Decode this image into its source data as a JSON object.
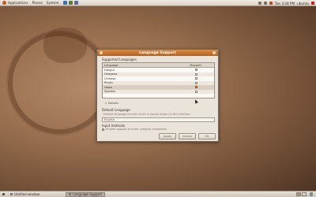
{
  "top_panel": {
    "menus": [
      "Applications",
      "Places",
      "System"
    ],
    "clock": "Tue 3:28 PM",
    "user": "ubuntu"
  },
  "window": {
    "title": "Language Support",
    "section_supported": "Supported Languages",
    "columns": [
      "Language",
      "Support",
      ""
    ],
    "languages": [
      {
        "name": "Hangul",
        "checked": false
      },
      {
        "name": "Hiragana",
        "checked": false
      },
      {
        "name": "Chinese",
        "checked": false
      },
      {
        "name": "Pinyin",
        "checked": false
      },
      {
        "name": "Hanzi",
        "checked": true
      },
      {
        "name": "Spanish",
        "checked": false
      }
    ],
    "details_label": "▷ Details",
    "default_language_label": "Default Language",
    "default_language_desc": "Default language for text which is usually shown in the interface.",
    "default_language_value": "English",
    "input_methods_label": "Input methods",
    "input_methods_checkbox": "Enable support to enter complex characters",
    "buttons": {
      "apply": "Apply",
      "cancel": "Cancel",
      "ok": "OK"
    }
  },
  "bottom_panel": {
    "tasks": [
      "Untitled window",
      "Language Support"
    ]
  }
}
